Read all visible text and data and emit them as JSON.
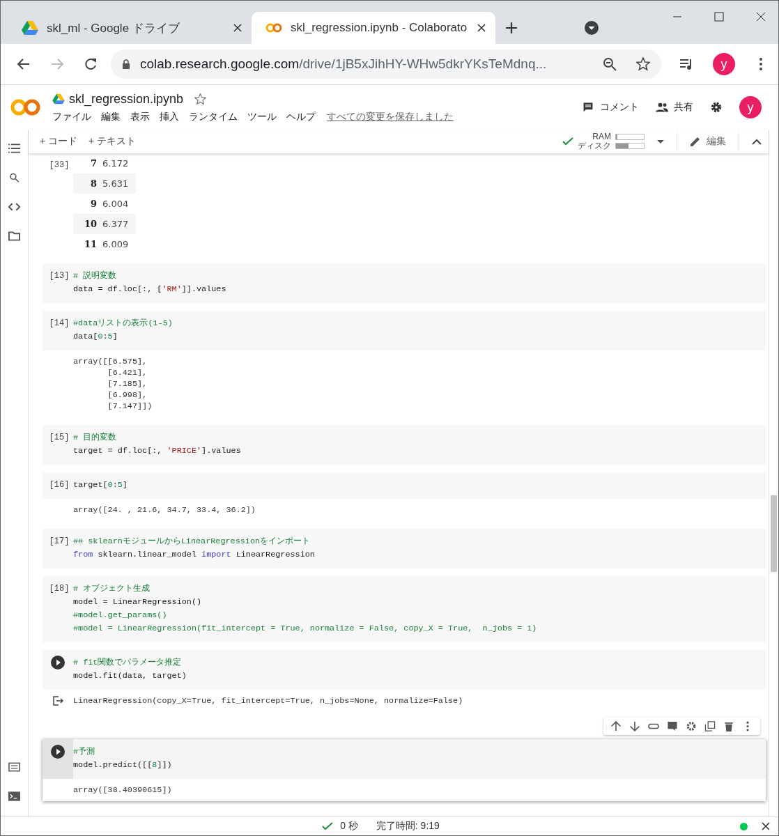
{
  "browser": {
    "tabs": [
      {
        "title": "skl_ml - Google ドライブ",
        "kind": "drive",
        "selected": false
      },
      {
        "title": "skl_regression.ipynb - Colaborato",
        "kind": "colab",
        "selected": true
      }
    ],
    "url_host": "colab.research.google.com",
    "url_path": "/drive/1jB5xJihHY-WHw5dkrYKsTeMdnq...",
    "profile": "y"
  },
  "notebook": {
    "title": "skl_regression.ipynb",
    "menus": [
      "ファイル",
      "編集",
      "表示",
      "挿入",
      "ランタイム",
      "ツール",
      "ヘルプ"
    ],
    "save_status": "すべての変更を保存しました",
    "comment": "コメント",
    "share": "共有",
    "avatar": "y"
  },
  "toolbar": {
    "add": [
      "+ コード",
      "+ テキスト"
    ],
    "ram_label": "RAM",
    "disk_label": "ディスク",
    "ram": {
      "level": 0.04
    },
    "disk": {
      "level": 0.45
    },
    "edit": "編集"
  },
  "cells": [
    {
      "exec": "[33]",
      "focused": false,
      "output": {
        "kind": "table",
        "rows": [
          [
            "7",
            "6.172"
          ],
          [
            "8",
            "5.631"
          ],
          [
            "9",
            "6.004"
          ],
          [
            "10",
            "6.377"
          ],
          [
            "11",
            "6.009"
          ]
        ]
      }
    },
    {
      "exec": "[13]",
      "focused": false,
      "code": [
        [
          {
            "kind": "comment",
            "text": "# 説明変数"
          }
        ],
        [
          {
            "kind": "plain",
            "text": "data = df.loc[:, ["
          },
          {
            "kind": "string",
            "text": "'RM'"
          },
          {
            "kind": "plain",
            "text": "]].values"
          }
        ]
      ]
    },
    {
      "exec": "[14]",
      "focused": false,
      "code": [
        [
          {
            "kind": "comment",
            "text": "#dataリストの表示(1-5)"
          }
        ],
        [
          {
            "kind": "plain",
            "text": "data["
          },
          {
            "kind": "number",
            "text": "0"
          },
          {
            "kind": "plain",
            "text": ":"
          },
          {
            "kind": "number",
            "text": "5"
          },
          {
            "kind": "plain",
            "text": "]"
          }
        ]
      ],
      "output": {
        "kind": "text",
        "icon": false,
        "lines": [
          "array([[6.575],",
          "       [6.421],",
          "       [7.185],",
          "       [6.998],",
          "       [7.147]])"
        ]
      }
    },
    {
      "exec": "[15]",
      "focused": false,
      "code": [
        [
          {
            "kind": "comment",
            "text": "# 目的変数"
          }
        ],
        [
          {
            "kind": "plain",
            "text": "target = df.loc[:, "
          },
          {
            "kind": "string",
            "text": "'PRICE'"
          },
          {
            "kind": "plain",
            "text": "].values"
          }
        ]
      ]
    },
    {
      "exec": "[16]",
      "focused": false,
      "code": [
        [
          {
            "kind": "plain",
            "text": "target["
          },
          {
            "kind": "number",
            "text": "0"
          },
          {
            "kind": "plain",
            "text": ":"
          },
          {
            "kind": "number",
            "text": "5"
          },
          {
            "kind": "plain",
            "text": "]"
          }
        ]
      ],
      "output": {
        "kind": "text",
        "icon": false,
        "lines": [
          "array([24. , 21.6, 34.7, 33.4, 36.2])"
        ]
      }
    },
    {
      "exec": "[17]",
      "focused": false,
      "code": [
        [
          {
            "kind": "comment",
            "text": "## sklearnモジュールからLinearRegressionをインポート"
          }
        ],
        [
          {
            "kind": "keyword",
            "text": "from"
          },
          {
            "kind": "plain",
            "text": " sklearn.linear_model "
          },
          {
            "kind": "keyword",
            "text": "import"
          },
          {
            "kind": "plain",
            "text": " LinearRegression"
          }
        ]
      ]
    },
    {
      "exec": "[18]",
      "focused": false,
      "code": [
        [
          {
            "kind": "comment",
            "text": "# オブジェクト生成"
          }
        ],
        [
          {
            "kind": "plain",
            "text": "model = LinearRegression()"
          }
        ],
        [
          {
            "kind": "comment",
            "text": "#model.get_params()"
          }
        ],
        [
          {
            "kind": "comment",
            "text": "#model = LinearRegression(fit_intercept = True, normalize = False, copy_X = True,  n_jobs = 1)"
          }
        ]
      ]
    },
    {
      "focused": false,
      "code": [
        [
          {
            "kind": "comment",
            "text": "# fit関数でパラメータ推定"
          }
        ],
        [
          {
            "kind": "plain",
            "text": "model.fit(data, target)"
          }
        ]
      ],
      "output": {
        "kind": "text",
        "icon": true,
        "lines": [
          "LinearRegression(copy_X=True, fit_intercept=True, n_jobs=None, normalize=False)"
        ]
      }
    },
    {
      "focused": true,
      "code": [
        [
          {
            "kind": "comment",
            "text": "#予測"
          }
        ],
        [
          {
            "kind": "plain",
            "text": "model.predict([["
          },
          {
            "kind": "number",
            "text": "8"
          },
          {
            "kind": "plain",
            "text": "]])"
          }
        ]
      ],
      "output": {
        "kind": "text",
        "icon": false,
        "lines": [
          "array([38.40390615])"
        ]
      }
    }
  ],
  "status_bar": {
    "duration": "0 秒",
    "completed": "完了時間: 9:19"
  }
}
